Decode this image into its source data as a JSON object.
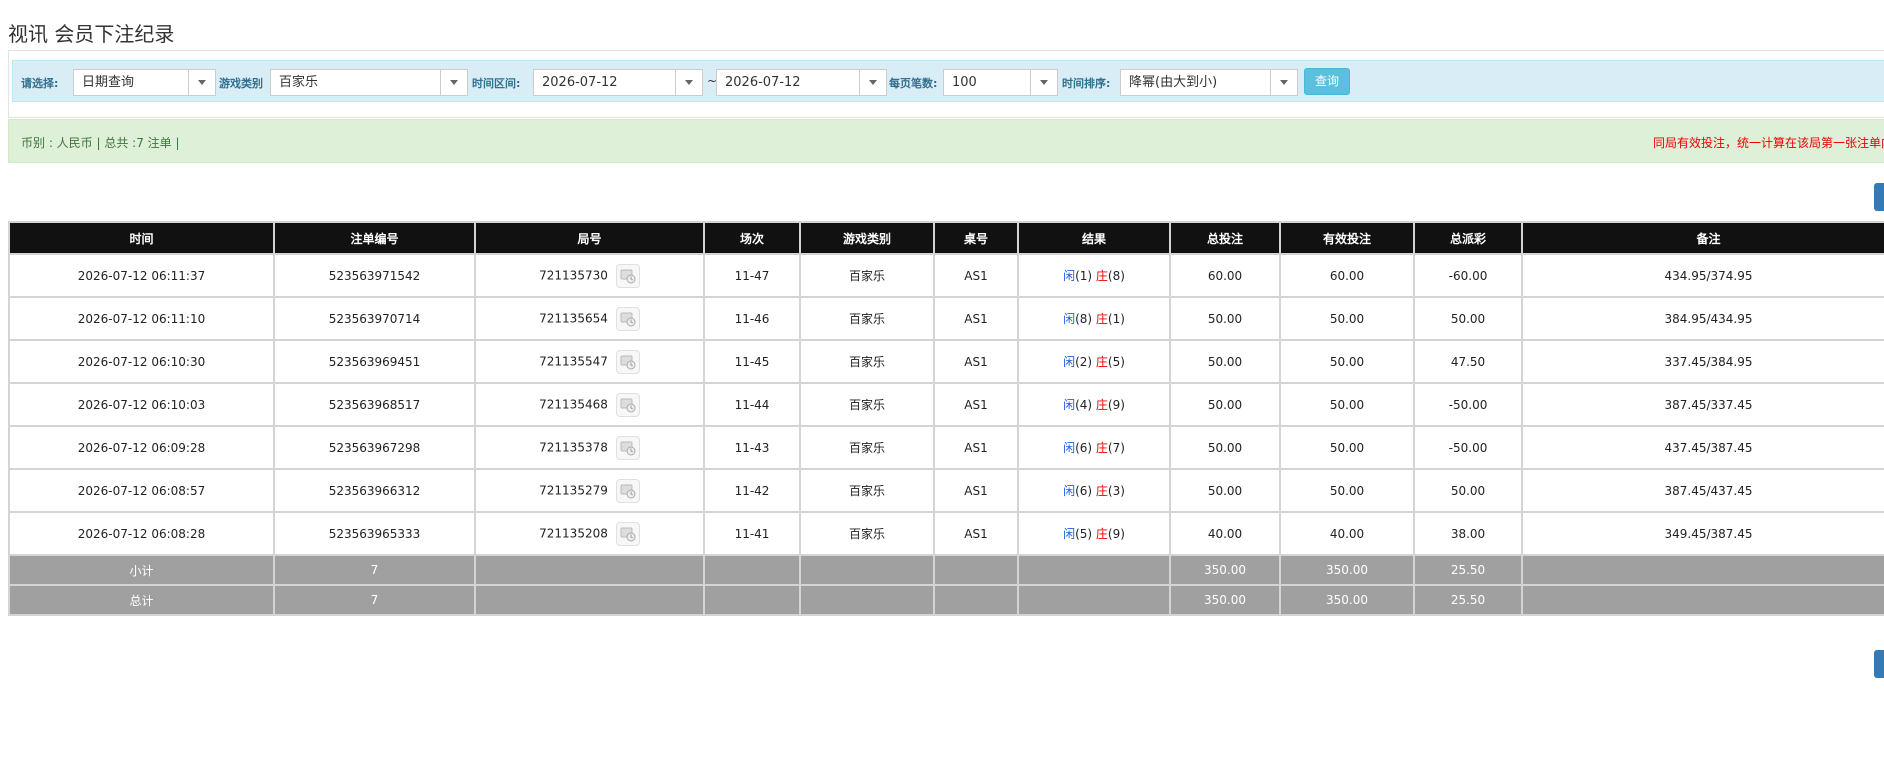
{
  "page": {
    "title": "视讯 会员下注纪录"
  },
  "filters": {
    "select_label": "请选择:",
    "select_value": "日期查询",
    "game_type_label": "游戏类别",
    "game_type_value": "百家乐",
    "time_range_label": "时间区间:",
    "date_from": "2026-07-12",
    "tilde": "~",
    "date_to": "2026-07-12",
    "per_page_label": "每页笔数:",
    "per_page_value": "100",
    "sort_label": "时间排序:",
    "sort_value": "降幂(由大到小)",
    "query_button": "查询"
  },
  "info": {
    "summary": "币别 : 人民币 | 总共 :7 注单 |",
    "notice": "同局有效投注，统一计算在该局第一张注单内"
  },
  "table": {
    "headers": [
      "时间",
      "注单编号",
      "局号",
      "场次",
      "游戏类别",
      "桌号",
      "结果",
      "总投注",
      "有效投注",
      "总派彩",
      "备注"
    ],
    "rows": [
      {
        "time": "2026-07-12 06:11:37",
        "bet_id": "523563971542",
        "round": "721135730",
        "session": "11-47",
        "game": "百家乐",
        "table": "AS1",
        "player_label": "闲",
        "player_score": "(1)",
        "banker_label": "庄",
        "banker_score": "(8)",
        "total_bet": "60.00",
        "valid_bet": "60.00",
        "payout": "-60.00",
        "payout_negative": true,
        "note": "434.95/374.95"
      },
      {
        "time": "2026-07-12 06:11:10",
        "bet_id": "523563970714",
        "round": "721135654",
        "session": "11-46",
        "game": "百家乐",
        "table": "AS1",
        "player_label": "闲",
        "player_score": "(8)",
        "banker_label": "庄",
        "banker_score": "(1)",
        "total_bet": "50.00",
        "valid_bet": "50.00",
        "payout": "50.00",
        "payout_negative": false,
        "note": "384.95/434.95"
      },
      {
        "time": "2026-07-12 06:10:30",
        "bet_id": "523563969451",
        "round": "721135547",
        "session": "11-45",
        "game": "百家乐",
        "table": "AS1",
        "player_label": "闲",
        "player_score": "(2)",
        "banker_label": "庄",
        "banker_score": "(5)",
        "total_bet": "50.00",
        "valid_bet": "50.00",
        "payout": "47.50",
        "payout_negative": false,
        "note": "337.45/384.95"
      },
      {
        "time": "2026-07-12 06:10:03",
        "bet_id": "523563968517",
        "round": "721135468",
        "session": "11-44",
        "game": "百家乐",
        "table": "AS1",
        "player_label": "闲",
        "player_score": "(4)",
        "banker_label": "庄",
        "banker_score": "(9)",
        "total_bet": "50.00",
        "valid_bet": "50.00",
        "payout": "-50.00",
        "payout_negative": true,
        "note": "387.45/337.45"
      },
      {
        "time": "2026-07-12 06:09:28",
        "bet_id": "523563967298",
        "round": "721135378",
        "session": "11-43",
        "game": "百家乐",
        "table": "AS1",
        "player_label": "闲",
        "player_score": "(6)",
        "banker_label": "庄",
        "banker_score": "(7)",
        "total_bet": "50.00",
        "valid_bet": "50.00",
        "payout": "-50.00",
        "payout_negative": true,
        "note": "437.45/387.45"
      },
      {
        "time": "2026-07-12 06:08:57",
        "bet_id": "523563966312",
        "round": "721135279",
        "session": "11-42",
        "game": "百家乐",
        "table": "AS1",
        "player_label": "闲",
        "player_score": "(6)",
        "banker_label": "庄",
        "banker_score": "(3)",
        "total_bet": "50.00",
        "valid_bet": "50.00",
        "payout": "50.00",
        "payout_negative": false,
        "note": "387.45/437.45"
      },
      {
        "time": "2026-07-12 06:08:28",
        "bet_id": "523563965333",
        "round": "721135208",
        "session": "11-41",
        "game": "百家乐",
        "table": "AS1",
        "player_label": "闲",
        "player_score": "(5)",
        "banker_label": "庄",
        "banker_score": "(9)",
        "total_bet": "40.00",
        "valid_bet": "40.00",
        "payout": "38.00",
        "payout_negative": false,
        "note": "349.45/387.45"
      }
    ],
    "subtotal": {
      "label": "小计",
      "count": "7",
      "total_bet": "350.00",
      "valid_bet": "350.00",
      "payout": "25.50"
    },
    "grand_total": {
      "label": "总计",
      "count": "7",
      "total_bet": "350.00",
      "valid_bet": "350.00",
      "payout": "25.50"
    }
  },
  "icons": {
    "replay": "round-replay-icon",
    "dropdown": "chevron-down-icon"
  },
  "colors": {
    "header_bg": "#111111",
    "filter_bg": "#d9edf7",
    "info_bg": "#dff0d8",
    "player_blue": "#1a5de6",
    "banker_red": "#e00000",
    "summary_bg": "#a0a0a0",
    "query_button": "#5bc0de"
  }
}
